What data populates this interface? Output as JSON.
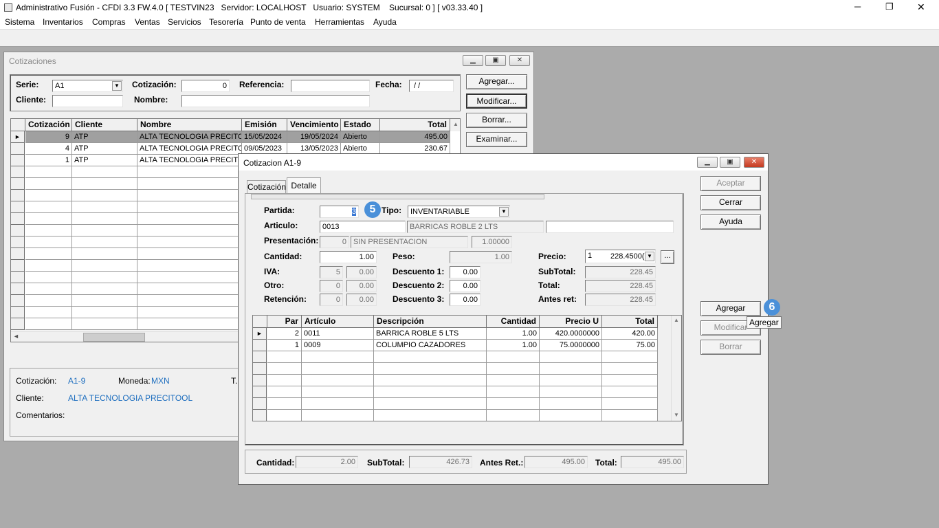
{
  "app": {
    "title": "Administrativo Fusión - CFDI 3.3 FW.4.0 [ TESTVIN23   Servidor: LOCALHOST   Usuario: SYSTEM    Sucursal: 0 ] [ v03.33.40 ]",
    "minimize": "─",
    "maximize": "❐",
    "close": "✕"
  },
  "menu": [
    "Sistema",
    "Inventarios",
    "Compras",
    "Ventas",
    "Servicios",
    "Tesorería",
    "Punto de venta",
    "Herramientas",
    "Ayuda"
  ],
  "cot": {
    "title": "Cotizaciones",
    "serie_label": "Serie:",
    "serie_value": "A1",
    "cotizacion_label": "Cotización:",
    "cotizacion_value": "0",
    "referencia_label": "Referencia:",
    "referencia_value": "",
    "fecha_label": "Fecha:",
    "fecha_value": " / /",
    "cliente_label": "Cliente:",
    "cliente_value": "",
    "nombre_label": "Nombre:",
    "nombre_value": "",
    "buttons": {
      "agregar": "Agregar...",
      "modificar": "Modificar...",
      "borrar": "Borrar...",
      "examinar": "Examinar..."
    },
    "columns": [
      "Cotización",
      "Cliente",
      "Nombre",
      "Emisión",
      "Vencimiento",
      "Estado",
      "Total"
    ],
    "rows": [
      [
        "9",
        "ATP",
        "ALTA TECNOLOGIA PRECITOOL",
        "15/05/2024",
        "19/05/2024",
        "Abierto",
        "495.00"
      ],
      [
        "4",
        "ATP",
        "ALTA TECNOLOGIA PRECITOOL",
        "09/05/2023",
        "13/05/2023",
        "Abierto",
        "230.67"
      ],
      [
        "1",
        "ATP",
        "ALTA TECNOLOGIA PRECITOOL",
        "",
        "",
        "",
        ""
      ]
    ],
    "info": {
      "cotizacion_label": "Cotización:",
      "cotizacion_value": "A1-9",
      "moneda_label": "Moneda:",
      "moneda_value": "MXN",
      "t_label": "T.",
      "cliente_label": "Cliente:",
      "cliente_value": "ALTA TECNOLOGIA PRECITOOL",
      "comentarios_label": "Comentarios:"
    }
  },
  "det": {
    "title": "Cotizacion A1-9",
    "tabs": [
      "Cotización",
      "Detalle"
    ],
    "partida_label": "Partida:",
    "partida_value": "3",
    "tipo_label": "Tipo:",
    "tipo_value": "INVENTARIABLE",
    "articulo_label": "Articulo:",
    "articulo_code": "0013",
    "articulo_desc": "BARRICAS ROBLE 2 LTS",
    "articulo_extra": "",
    "presentacion_label": "Presentación:",
    "presentacion_code": "0",
    "presentacion_desc": "SIN PRESENTACION",
    "presentacion_factor": "1.00000",
    "cantidad_label": "Cantidad:",
    "cantidad_value": "1.00",
    "peso_label": "Peso:",
    "peso_value": "1.00",
    "precio_label": "Precio:",
    "precio_list": "1",
    "precio_value": "228.4500(",
    "iva_label": "IVA:",
    "iva_code": "5",
    "iva_value": "0.00",
    "otro_label": "Otro:",
    "otro_code": "0",
    "otro_value": "0.00",
    "retencion_label": "Retención:",
    "retencion_code": "0",
    "retencion_value": "0.00",
    "desc1_label": "Descuento 1:",
    "desc1_value": "0.00",
    "desc2_label": "Descuento 2:",
    "desc2_value": "0.00",
    "desc3_label": "Descuento 3:",
    "desc3_value": "0.00",
    "subtotal_label": "SubTotal:",
    "subtotal_value": "228.45",
    "total_label": "Total:",
    "total_value": "228.45",
    "antesret_label": "Antes ret:",
    "antesret_value": "228.45",
    "ellipsis": "...",
    "columns": [
      "Par",
      "Artículo",
      "Descripción",
      "Cantidad",
      "Precio U",
      "Total"
    ],
    "rows": [
      [
        "2",
        "0011",
        "BARRICA ROBLE 5 LTS",
        "1.00",
        "420.0000000",
        "420.00"
      ],
      [
        "1",
        "0009",
        "COLUMPIO CAZADORES",
        "1.00",
        "75.0000000",
        "75.00"
      ]
    ],
    "buttons": {
      "aceptar": "Aceptar",
      "cerrar": "Cerrar",
      "ayuda": "Ayuda",
      "agregar": "Agregar",
      "modificar": "Modificar",
      "borrar": "Borrar"
    },
    "tooltip": "Agregar",
    "footer": {
      "cantidad_label": "Cantidad:",
      "cantidad_value": "2.00",
      "subtotal_label": "SubTotal:",
      "subtotal_value": "426.73",
      "antesret_label": "Antes Ret.:",
      "antesret_value": "495.00",
      "total_label": "Total:",
      "total_value": "495.00"
    }
  },
  "badges": {
    "b5": "5",
    "b6": "6"
  },
  "colors": {
    "highlight_row": "#a0a0a0",
    "badge": "#4a90d9",
    "link_blue": "#1f6fbf"
  }
}
